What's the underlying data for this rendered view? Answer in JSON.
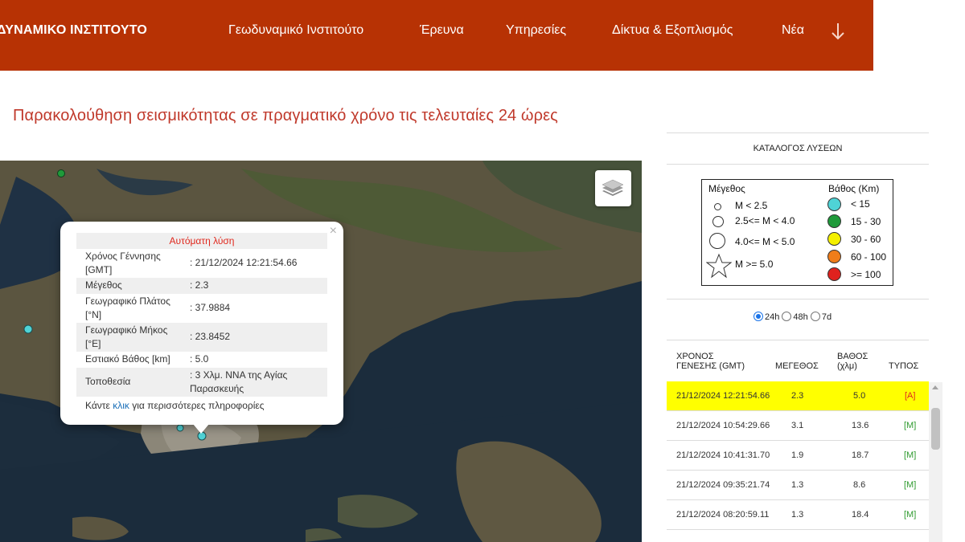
{
  "header": {
    "logo": "ΔΥΝΑΜΙΚΟ ΙΝΣΤΙΤΟΥΤΟ",
    "nav": [
      "Γεωδυναμικό Ινστιτούτο",
      "Έρευνα",
      "Υπηρεσίες",
      "Δίκτυα & Εξοπλισμός",
      "Νέα"
    ],
    "accent": "#b73204"
  },
  "page": {
    "title": "Παρακολούθηση σεισμικότητας σε πραγματικό χρόνο τις τελευταίες 24 ώρες"
  },
  "popup": {
    "heading": "Αυτόματη λύση",
    "close": "×",
    "rows": [
      {
        "key": "Χρόνος Γέννησης [GMT]",
        "key_l1": "Χρόνος Γέννησης",
        "key_l2": "[GMT]",
        "value": ": 21/12/2024 12:21:54.66"
      },
      {
        "key": "Μέγεθος",
        "value": ": 2.3"
      },
      {
        "key": "Γεωγραφικό Πλάτος [°N]",
        "key_l1": "Γεωγραφικό Πλάτος",
        "key_l2": "[°N]",
        "value": ": 37.9884"
      },
      {
        "key": "Γεωγραφικό Μήκος [°E]",
        "key_l1": "Γεωγραφικό Μήκος",
        "key_l2": "[°E]",
        "value": ": 23.8452"
      },
      {
        "key": "Εστιακό Βάθος [km]",
        "value": ": 5.0"
      },
      {
        "key": "Τοποθεσία",
        "value": ": 3 Χλμ. ΝΝΑ της Αγίας Παρασκευής",
        "value_l1": ": 3 Χλμ. ΝΝΑ της Αγίας",
        "value_l2": "Παρασκευής"
      }
    ],
    "footer_pre": "Κάντε ",
    "footer_link": "κλικ",
    "footer_post": " για περισσότερες πληροφορίες"
  },
  "side": {
    "title": "ΚΑΤΑΛΟΓΟΣ ΛΥΣΕΩΝ",
    "legend": {
      "magnitude_title": "Μέγεθος",
      "magnitude": [
        "M < 2.5",
        "2.5<= M < 4.0",
        "4.0<= M < 5.0",
        "M >= 5.0"
      ],
      "depth_title": "Βάθος (Km)",
      "depth": [
        {
          "label": "< 15",
          "color": "#4fd3d6"
        },
        {
          "label": "15 - 30",
          "color": "#1f9a3a"
        },
        {
          "label": "30 - 60",
          "color": "#f4f000"
        },
        {
          "label": "60 - 100",
          "color": "#f07d1a"
        },
        {
          "label": ">= 100",
          "color": "#e0221e"
        }
      ]
    },
    "periods": {
      "selected": "24h",
      "options": [
        "24h",
        "48h",
        "7d"
      ]
    },
    "table": {
      "headers": {
        "time_l1": "ΧΡΟΝΟΣ",
        "time_l2": "ΓΕΝΕΣΗΣ (GMT)",
        "magnitude": "ΜΕΓΕΘΟΣ",
        "depth_l1": "ΒΑΘΟΣ",
        "depth_l2": "(χλμ)",
        "type": "ΤΥΠΟΣ"
      },
      "rows": [
        {
          "time": "21/12/2024 12:21:54.66",
          "magnitude": "2.3",
          "depth": "5.0",
          "type": "[A]"
        },
        {
          "time": "21/12/2024 10:54:29.66",
          "magnitude": "3.1",
          "depth": "13.6",
          "type": "[M]"
        },
        {
          "time": "21/12/2024 10:41:31.70",
          "magnitude": "1.9",
          "depth": "18.7",
          "type": "[M]"
        },
        {
          "time": "21/12/2024 09:35:21.74",
          "magnitude": "1.3",
          "depth": "8.6",
          "type": "[M]"
        },
        {
          "time": "21/12/2024 08:20:59.11",
          "magnitude": "1.3",
          "depth": "18.4",
          "type": "[M]"
        }
      ],
      "highlight_color": "#ffff00"
    }
  },
  "map": {
    "event_color_shallow": "#4fd3d6",
    "event_color_mid": "#1f9a3a"
  }
}
